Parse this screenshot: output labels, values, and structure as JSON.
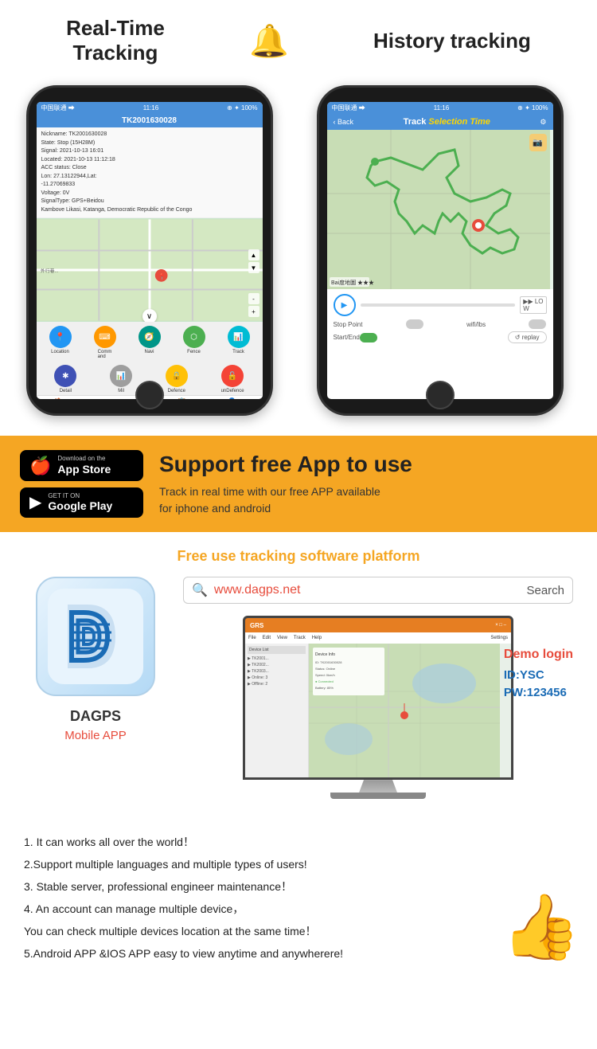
{
  "header": {
    "realtime_title": "Real-Time\nTracking",
    "bell_icon": "🔔",
    "history_title": "History tracking"
  },
  "phone1": {
    "status_carrier": "中国联通 ➡",
    "status_time": "11:16",
    "status_icons": "⊕ ✦ 100%",
    "tracker_id": "TK2001630028",
    "info_nickname": "Nickname: TK2001630028",
    "info_state": "State: Stop (15H28M)",
    "info_signal": "Signal: 2021-10-13 16:01",
    "info_located": "Located: 2021-10-13 11:12:18",
    "info_acc": "ACC status: Close",
    "info_lon": "Lon: 27.13122944,Lat:",
    "info_lat": "-11.27069833",
    "info_voltage": "Voltage: 0V",
    "info_signal_type": "SignalType: GPS+Beidou",
    "info_location": "Kambove Likasi, Katanga, Democratic Republic of the Congo",
    "btns_row1": [
      "Location",
      "Command",
      "Navi",
      "Fence",
      "Track"
    ],
    "btns_row2": [
      "Detail",
      "Mil",
      "Defence",
      "unDefence"
    ],
    "nav_items": [
      "Main",
      "List",
      "Alarm",
      "Report",
      "User Center"
    ]
  },
  "phone2": {
    "status_carrier": "中国联通 ➡",
    "status_time": "11:16",
    "status_icons": "⊕ ✦ 100%",
    "back_label": "Back",
    "screen_title": "Track Selection Time",
    "stop_point": "Stop Point",
    "wifi_lbs": "wifi/lbs",
    "start_end": "Start/End",
    "replay": "↺ replay",
    "speed": "LO\nW"
  },
  "yellow_section": {
    "app_store_top": "Download on the",
    "app_store_name": "App Store",
    "google_play_top": "GET IT ON",
    "google_play_name": "Google Play",
    "support_title": "Support free App to use",
    "support_desc": "Track in real time with our free APP available\nfor iphone and android"
  },
  "platform_section": {
    "title": "Free use tracking software platform",
    "search_url": "www.dagps.net",
    "search_btn": "Search",
    "app_name": "DAGPS",
    "mobile_app_label": "Mobile APP",
    "demo_label": "Demo login",
    "demo_id": "ID:YSC",
    "demo_pw": "PW:123456"
  },
  "features": {
    "items": [
      "1. It can works all over the world！",
      "2.Support multiple languages and multiple types of users!",
      "3. Stable server, professional engineer maintenance！",
      "4. An account can manage multiple device，",
      "You can check multiple devices location at the same time！",
      "5.Android APP &IOS APP easy to view anytime and anywherere!"
    ]
  }
}
